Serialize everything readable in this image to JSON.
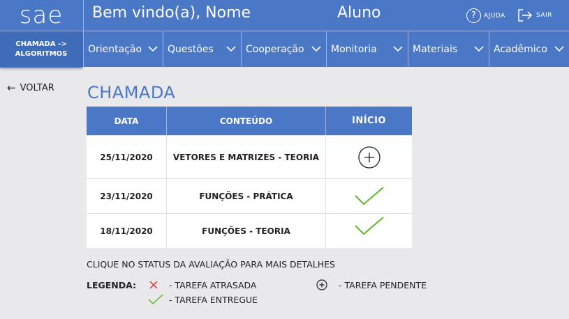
{
  "header": {
    "logo": "sae",
    "welcome": "Bem vindo(a), Nome",
    "role": "Aluno",
    "help_label": "AJUDA",
    "logout_label": "SAIR"
  },
  "nav": {
    "breadcrumb_line1": "CHAMADA ->",
    "breadcrumb_line2": "ALGORITMOS",
    "items": [
      {
        "label": "Orientação"
      },
      {
        "label": "Questões"
      },
      {
        "label": "Cooperação"
      },
      {
        "label": "Monitoria"
      },
      {
        "label": "Materiais"
      },
      {
        "label": "Acadêmico"
      }
    ]
  },
  "back_label": "VOLTAR",
  "page_title": "CHAMADA",
  "table": {
    "headers": {
      "date": "DATA",
      "content": "CONTEÚDO",
      "start": "INÍCIO"
    },
    "rows": [
      {
        "date": "25/11/2020",
        "content": "VETORES E MATRIZES - TEORIA",
        "status": "pending"
      },
      {
        "date": "23/11/2020",
        "content": "FUNÇÕES - PRÁTICA",
        "status": "delivered"
      },
      {
        "date": "18/11/2020",
        "content": "FUNÇÕES - TEORIA",
        "status": "delivered"
      }
    ]
  },
  "instructions": "CLIQUE NO STATUS DA AVALIAÇÃO PARA MAIS DETALHES",
  "legend": {
    "title": "LEGENDA:",
    "late": "-  TAREFA ATRASADA",
    "delivered": "-  TAREFA ENTREGUE",
    "pending": "-  TAREFA PENDENTE"
  },
  "colors": {
    "primary": "#4a78c7",
    "check": "#5fb829",
    "late": "#e03434"
  }
}
